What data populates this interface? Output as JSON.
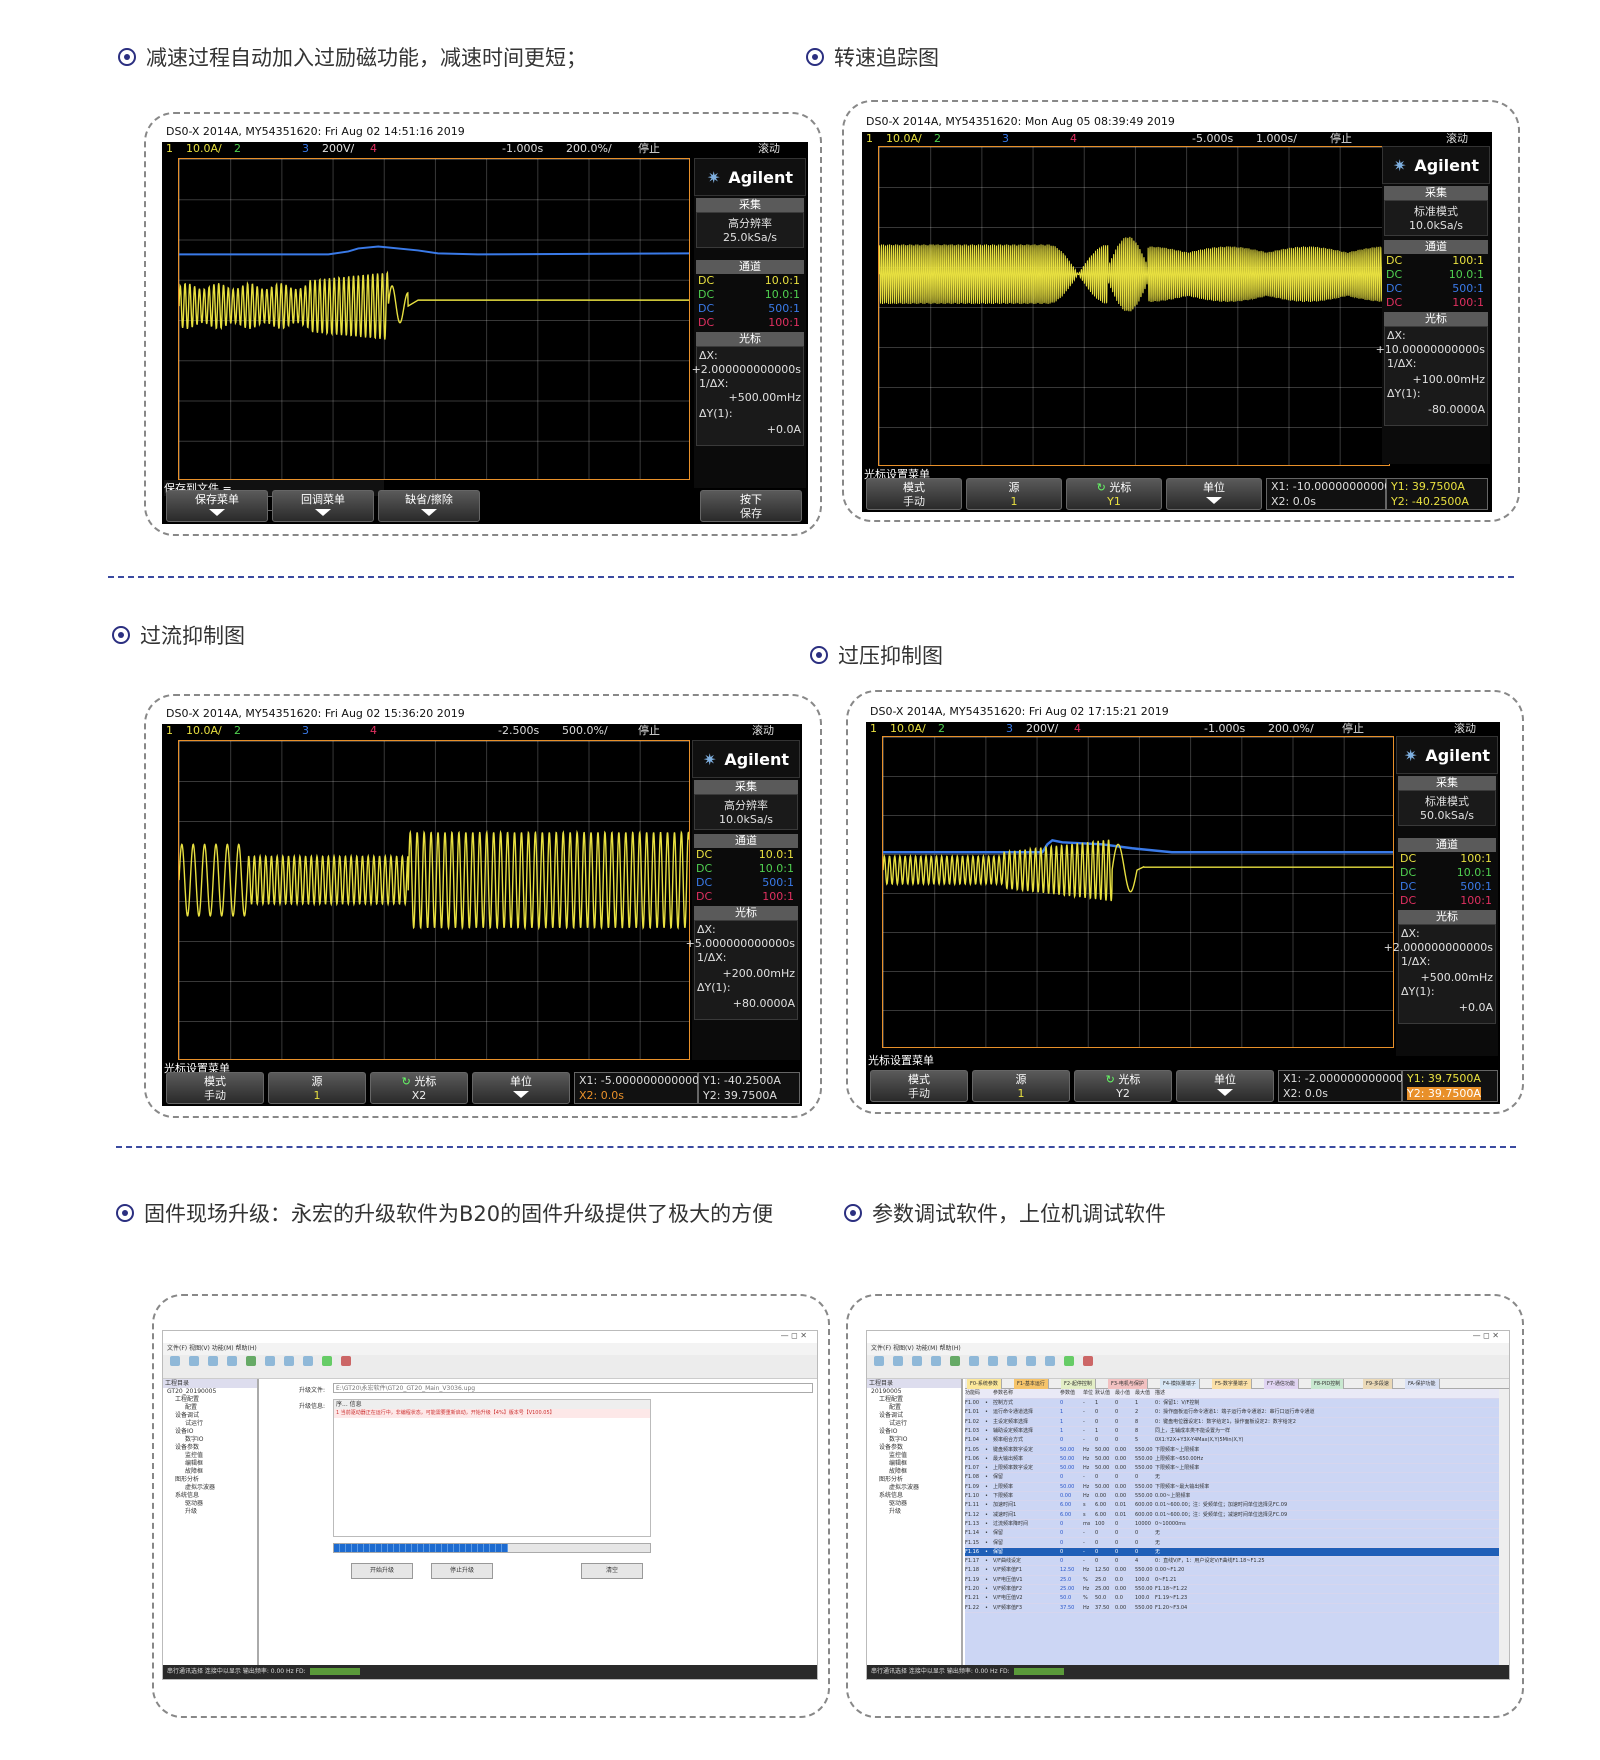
{
  "headings": {
    "decel": "减速过程自动加入过励磁功能，减速时间更短；",
    "speed": "转速追踪图",
    "overcurrent": "过流抑制图",
    "overvoltage": "过压抑制图",
    "firmware": "固件现场升级：永宏的升级软件为B20的固件升级提供了极大的方便",
    "param": "参数调试软件，上位机调试软件"
  },
  "scopes": {
    "s1": {
      "header": "DS0-X 2014A, MY54351620: Fri Aug 02 14:51:16 2019",
      "top": {
        "ch1": "1",
        "ch1v": "10.0A/",
        "ch2": "2",
        "ch3": "3",
        "ch3v": "200V/",
        "ch4": "4",
        "time": "-1.000s",
        "div": "200.0%/",
        "state": "停止",
        "roll": "滚动"
      },
      "logo": "Agilent",
      "acq_title": "采集",
      "acq_mode": "高分辨率",
      "acq_rate": "25.0kSa/s",
      "ch_title": "通道",
      "channels": [
        {
          "c": "DC",
          "v": "10.0:1"
        },
        {
          "c": "DC",
          "v": "10.0:1"
        },
        {
          "c": "DC",
          "v": "500:1"
        },
        {
          "c": "DC",
          "v": "100:1"
        }
      ],
      "cursor_title": "光标",
      "dx_label": "ΔX:",
      "dx": "+2.000000000000s",
      "inv_label": "1/ΔX:",
      "inv": "+500.00mHz",
      "dy_label": "ΔY(1):",
      "dy": "+0.0A",
      "save_label": "保存到文件 =",
      "save_value": "scope_26",
      "keys": [
        "保存菜单",
        "回调菜单",
        "缺省/擦除"
      ],
      "press_key": "按下",
      "press_key2": "保存"
    },
    "s2": {
      "header": "DS0-X 2014A, MY54351620: Mon Aug 05 08:39:49 2019",
      "top": {
        "ch1": "1",
        "ch1v": "10.0A/",
        "ch2": "2",
        "ch3": "3",
        "ch4": "4",
        "time": "-5.000s",
        "div": "1.000s/",
        "state": "停止",
        "roll": "滚动"
      },
      "logo": "Agilent",
      "acq_title": "采集",
      "acq_mode": "标准模式",
      "acq_rate": "10.0kSa/s",
      "ch_title": "通道",
      "channels": [
        {
          "c": "DC",
          "v": "100:1"
        },
        {
          "c": "DC",
          "v": "10.0:1"
        },
        {
          "c": "DC",
          "v": "500:1"
        },
        {
          "c": "DC",
          "v": "100:1"
        }
      ],
      "cursor_title": "光标",
      "dx_label": "ΔX:",
      "dx": "+10.00000000000s",
      "inv_label": "1/ΔX:",
      "inv": "+100.00mHz",
      "dy_label": "ΔY(1):",
      "dy": "-80.0000A",
      "menu_title": "光标设置菜单",
      "k_mode": "模式",
      "k_mode_sub": "手动",
      "k_src": "源",
      "k_src_sub": "1",
      "k_cur": "光标",
      "k_cur_sub": "Y1",
      "k_unit": "单位",
      "info": {
        "x1": "X1: -10.00000000000s",
        "x2": "X2: 0.0s",
        "y1": "Y1: 39.7500A",
        "y2": "Y2: -40.2500A"
      }
    },
    "s3": {
      "header": "DS0-X 2014A, MY54351620: Fri Aug 02 15:36:20 2019",
      "top": {
        "ch1": "1",
        "ch1v": "10.0A/",
        "ch2": "2",
        "ch3": "3",
        "ch4": "4",
        "time": "-2.500s",
        "div": "500.0%/",
        "state": "停止",
        "roll": "滚动"
      },
      "logo": "Agilent",
      "acq_title": "采集",
      "acq_mode": "高分辨率",
      "acq_rate": "10.0kSa/s",
      "ch_title": "通道",
      "channels": [
        {
          "c": "DC",
          "v": "10.0:1"
        },
        {
          "c": "DC",
          "v": "10.0:1"
        },
        {
          "c": "DC",
          "v": "500:1"
        },
        {
          "c": "DC",
          "v": "100:1"
        }
      ],
      "cursor_title": "光标",
      "dx_label": "ΔX:",
      "dx": "+5.000000000000s",
      "inv_label": "1/ΔX:",
      "inv": "+200.00mHz",
      "dy_label": "ΔY(1):",
      "dy": "+80.0000A",
      "menu_title": "光标设置菜单",
      "k_mode": "模式",
      "k_mode_sub": "手动",
      "k_src": "源",
      "k_src_sub": "1",
      "k_cur": "光标",
      "k_cur_sub": "X2",
      "k_unit": "单位",
      "info": {
        "x1": "X1: -5.000000000000s",
        "x2": "X2: 0.0s",
        "y1": "Y1: -40.2500A",
        "y2": "Y2: 39.7500A"
      }
    },
    "s4": {
      "header": "DS0-X 2014A, MY54351620: Fri Aug 02 17:15:21 2019",
      "top": {
        "ch1": "1",
        "ch1v": "10.0A/",
        "ch2": "2",
        "ch3": "3",
        "ch3v": "200V/",
        "ch4": "4",
        "time": "-1.000s",
        "div": "200.0%/",
        "state": "停止",
        "roll": "滚动"
      },
      "logo": "Agilent",
      "acq_title": "采集",
      "acq_mode": "标准模式",
      "acq_rate": "50.0kSa/s",
      "ch_title": "通道",
      "channels": [
        {
          "c": "DC",
          "v": "100:1"
        },
        {
          "c": "DC",
          "v": "10.0:1"
        },
        {
          "c": "DC",
          "v": "500:1"
        },
        {
          "c": "DC",
          "v": "100:1"
        }
      ],
      "cursor_title": "光标",
      "dx_label": "ΔX:",
      "dx": "+2.000000000000s",
      "inv_label": "1/ΔX:",
      "inv": "+500.00mHz",
      "dy_label": "ΔY(1):",
      "dy": "+0.0A",
      "menu_title": "光标设置菜单",
      "k_mode": "模式",
      "k_mode_sub": "手动",
      "k_src": "源",
      "k_src_sub": "1",
      "k_cur": "光标",
      "k_cur_sub": "Y2",
      "k_unit": "单位",
      "info": {
        "x1": "X1: -2.000000000000s",
        "x2": "X2: 0.0s",
        "y1": "Y1: 39.7500A",
        "y2": "Y2: 39.7500A"
      }
    }
  },
  "firmware_app": {
    "window_controls": "—  ◻  ✕",
    "menu": "文件(F)  视图(V)  功能(M)  帮助(H)",
    "tree_title": "工程目录",
    "tree": [
      "GT20_20190005",
      "工程配置",
      "配置",
      "设备调试",
      "试运行",
      "设备IO",
      "数字IO",
      "设备参数",
      "监控值",
      "编辑框",
      "故障框",
      "图形分析",
      "虚拟示波器",
      "系统信息",
      "驱动器",
      "升级"
    ],
    "file_label": "升级文件:",
    "file_value": "E:\\GT20\\永宏软件\\GT20_GT20_Main_V3036.upg",
    "info_label": "升级信息:",
    "log_header": "序...  信息",
    "log_line": "1  当前驱动器正在运行中，非编程状态，可能需要重新启动，开始升级【4%】版本号【V100.05】",
    "progress_pct": 0.55,
    "btn_start": "开始升级",
    "btn_stop": "停止升级",
    "btn_clear": "清空",
    "status": "串行通讯选择    连接中以显示    输出频率: 0.00 Hz    FD:"
  },
  "param_app": {
    "window_controls": "—  ◻  ✕",
    "menu": "文件(F)  视图(V)  功能(M)  帮助(H)",
    "tree_title": "工程目录",
    "tree": [
      "20190005",
      "工程配置",
      "配置",
      "设备调试",
      "试运行",
      "设备IO",
      "数字IO",
      "设备参数",
      "监控值",
      "编辑框",
      "故障框",
      "图形分析",
      "虚拟示波器",
      "系统信息",
      "驱动器",
      "升级"
    ],
    "tabs": [
      "F0-系统参数",
      "F1-基本运行",
      "F2-起停控制",
      "F3-电机与保护",
      "F4-模拟量端子",
      "F5-数字量端子",
      "F7-通信功能",
      "F8-PID控制",
      "F9-多段速",
      "FA-保护功能"
    ],
    "columns": [
      "功能码",
      "",
      "参数名称",
      "参数值",
      "单位",
      "默认值",
      "最小值",
      "最大值",
      "描述"
    ],
    "rows": [
      [
        "F1.00",
        "控制方式",
        "0",
        "-",
        "1",
        "0",
        "1",
        "0：保留1：V/F控制"
      ],
      [
        "F1.01",
        "运行命令通道选择",
        "1",
        "-",
        "0",
        "0",
        "2",
        "0：操作面板运行命令通道1：端子运行命令通道2：串行口运行命令通道"
      ],
      [
        "F1.02",
        "主设定频率选择",
        "1",
        "-",
        "0",
        "0",
        "8",
        "0：键盘电位器设定1：数字给定1，操作面板设定2：数字给定2"
      ],
      [
        "F1.03",
        "辅助设定频率选择",
        "1",
        "-",
        "1",
        "0",
        "8",
        "同上，主辅成本类不能设置为一样"
      ],
      [
        "F1.04",
        "频率组合方式",
        "0",
        "-",
        "0",
        "0",
        "5",
        "0X1:Y2X+Y3X-Y4Max(X,Y)5Min(X,Y)"
      ],
      [
        "F1.05",
        "键盘频率数字设定",
        "50.00",
        "Hz",
        "50.00",
        "0.00",
        "550.00",
        "下限频率~上限频率"
      ],
      [
        "F1.06",
        "最大输出频率",
        "50.00",
        "Hz",
        "50.00",
        "0.00",
        "550.00",
        "上限频率~650.00Hz"
      ],
      [
        "F1.07",
        "上限频率数字设定",
        "50.00",
        "Hz",
        "50.00",
        "0.00",
        "550.00",
        "下限频率~上限频率"
      ],
      [
        "F1.08",
        "保留",
        "0",
        "-",
        "0",
        "0",
        "0",
        "无"
      ],
      [
        "F1.09",
        "上限频率",
        "50.00",
        "Hz",
        "50.00",
        "0.00",
        "550.00",
        "下限频率~最大输出频率"
      ],
      [
        "F1.10",
        "下限频率",
        "0.00",
        "Hz",
        "0.00",
        "0.00",
        "550.00",
        "0.00~上限频率"
      ],
      [
        "F1.11",
        "加速时间1",
        "6.00",
        "s",
        "6.00",
        "0.01",
        "600.00",
        "0.01~600.00；注：受频单位；加速时间单位选择见FC.09"
      ],
      [
        "F1.12",
        "减速时间1",
        "6.00",
        "s",
        "6.00",
        "0.01",
        "600.00",
        "0.01~600.00；注：受频单位；减速时间单位选择见FC.09"
      ],
      [
        "F1.13",
        "过流频率降时间",
        "0",
        "ms",
        "100",
        "0",
        "10000",
        "0~10000ms"
      ],
      [
        "F1.14",
        "保留",
        "0",
        "-",
        "0",
        "0",
        "0",
        "无"
      ],
      [
        "F1.15",
        "保留",
        "0",
        "-",
        "0",
        "0",
        "0",
        "无"
      ],
      [
        "F1.16",
        "保留",
        "0",
        "-",
        "0",
        "0",
        "0",
        "无"
      ],
      [
        "F1.17",
        "V/F曲线设定",
        "0",
        "-",
        "0",
        "0",
        "4",
        "0：直线V/F，1：用户设定V/F曲线F1.18~F1.25"
      ],
      [
        "F1.18",
        "V/F频率值F1",
        "12.50",
        "Hz",
        "12.50",
        "0.00",
        "550.00",
        "0.00~F1.20"
      ],
      [
        "F1.19",
        "V/F电压值V1",
        "25.0",
        "%",
        "25.0",
        "0.0",
        "100.0",
        "0~F1.21"
      ],
      [
        "F1.20",
        "V/F频率值F2",
        "25.00",
        "Hz",
        "25.00",
        "0.00",
        "550.00",
        "F1.18~F1.22"
      ],
      [
        "F1.21",
        "V/F电压值V2",
        "50.0",
        "%",
        "50.0",
        "0.0",
        "100.0",
        "F1.19~F1.23"
      ],
      [
        "F1.22",
        "V/F频率值F3",
        "37.50",
        "Hz",
        "37.50",
        "0.00",
        "550.00",
        "F1.20~F3.04"
      ]
    ],
    "selected_row": 16,
    "status": "串行通讯选择    连接中以显示    输出频率: 0.00 Hz    FD:"
  },
  "colors": {
    "bullet": "#2b2f80",
    "ch1": "#e8e040",
    "ch2": "#50d050",
    "ch3": "#3a7ae8",
    "ch4": "#e03060",
    "grid_border": "#e8902a"
  }
}
